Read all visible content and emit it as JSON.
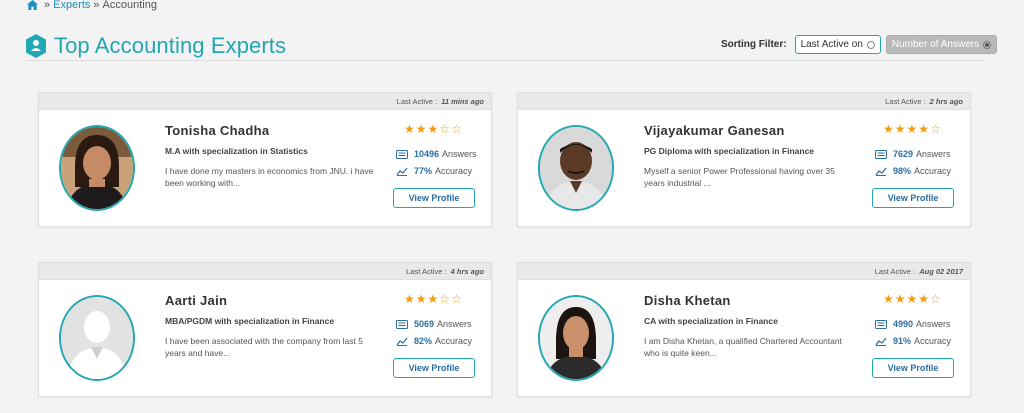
{
  "breadcrumb": {
    "sep1": "»",
    "experts": "Experts",
    "sep2": "»",
    "current": "Accounting"
  },
  "page_title": "Top Accounting Experts",
  "sorting": {
    "label": "Sorting Filter:",
    "option1": "Last Active on",
    "option2": "Number of Answers",
    "selected": "Number of Answers"
  },
  "colors": {
    "accent": "#21a7b3",
    "star": "#f39c12",
    "link": "#2b6ea0"
  },
  "experts": [
    {
      "last_active_label": "Last Active :",
      "last_active": "11 mins ago",
      "name": "Tonisha Chadha",
      "specialization": "M.A with specialization in Statistics",
      "bio": "I have done my masters in economics from JNU. i have been working with...",
      "rating": 3,
      "answers": "10496",
      "answers_label": "Answers",
      "accuracy": "77%",
      "accuracy_label": "Accuracy",
      "button": "View Profile",
      "avatar": "photo-woman-1"
    },
    {
      "last_active_label": "Last Active :",
      "last_active": "2 hrs ago",
      "name": "Vijayakumar Ganesan",
      "specialization": "PG Diploma with specialization in Finance",
      "bio": "Myself a senior Power Professional having over 35 years industrial ...",
      "rating": 4,
      "answers": "7629",
      "answers_label": "Answers",
      "accuracy": "98%",
      "accuracy_label": "Accuracy",
      "button": "View Profile",
      "avatar": "photo-man"
    },
    {
      "last_active_label": "Last Active :",
      "last_active": "4 hrs ago",
      "name": "Aarti Jain",
      "specialization": "MBA/PGDM with specialization in Finance",
      "bio": "I have been associated with the company from last 5 years and have...",
      "rating": 3,
      "answers": "5069",
      "answers_label": "Answers",
      "accuracy": "82%",
      "accuracy_label": "Accuracy",
      "button": "View Profile",
      "avatar": "placeholder-person"
    },
    {
      "last_active_label": "Last Active :",
      "last_active": "Aug 02 2017",
      "name": "Disha Khetan",
      "specialization": "CA with specialization in Finance",
      "bio": "I am Disha Khetan, a qualified Chartered Accountant who is quite keen...",
      "rating": 4,
      "answers": "4990",
      "answers_label": "Answers",
      "accuracy": "91%",
      "accuracy_label": "Accuracy",
      "button": "View Profile",
      "avatar": "photo-woman-2"
    }
  ]
}
